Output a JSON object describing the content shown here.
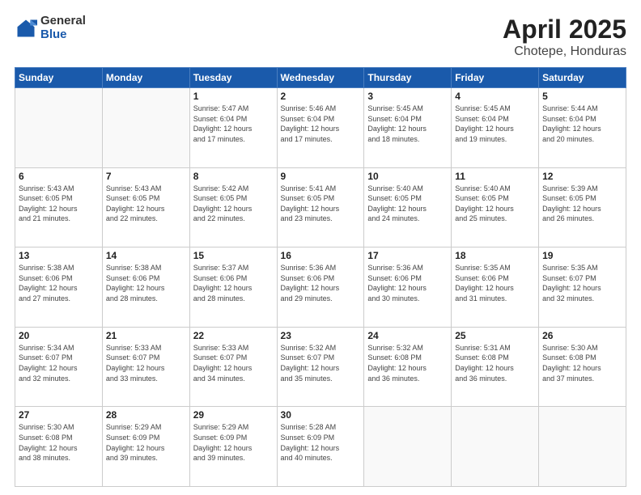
{
  "header": {
    "logo_general": "General",
    "logo_blue": "Blue",
    "title": "April 2025",
    "subtitle": "Chotepe, Honduras"
  },
  "weekdays": [
    "Sunday",
    "Monday",
    "Tuesday",
    "Wednesday",
    "Thursday",
    "Friday",
    "Saturday"
  ],
  "weeks": [
    [
      {
        "day": "",
        "info": ""
      },
      {
        "day": "",
        "info": ""
      },
      {
        "day": "1",
        "info": "Sunrise: 5:47 AM\nSunset: 6:04 PM\nDaylight: 12 hours\nand 17 minutes."
      },
      {
        "day": "2",
        "info": "Sunrise: 5:46 AM\nSunset: 6:04 PM\nDaylight: 12 hours\nand 17 minutes."
      },
      {
        "day": "3",
        "info": "Sunrise: 5:45 AM\nSunset: 6:04 PM\nDaylight: 12 hours\nand 18 minutes."
      },
      {
        "day": "4",
        "info": "Sunrise: 5:45 AM\nSunset: 6:04 PM\nDaylight: 12 hours\nand 19 minutes."
      },
      {
        "day": "5",
        "info": "Sunrise: 5:44 AM\nSunset: 6:04 PM\nDaylight: 12 hours\nand 20 minutes."
      }
    ],
    [
      {
        "day": "6",
        "info": "Sunrise: 5:43 AM\nSunset: 6:05 PM\nDaylight: 12 hours\nand 21 minutes."
      },
      {
        "day": "7",
        "info": "Sunrise: 5:43 AM\nSunset: 6:05 PM\nDaylight: 12 hours\nand 22 minutes."
      },
      {
        "day": "8",
        "info": "Sunrise: 5:42 AM\nSunset: 6:05 PM\nDaylight: 12 hours\nand 22 minutes."
      },
      {
        "day": "9",
        "info": "Sunrise: 5:41 AM\nSunset: 6:05 PM\nDaylight: 12 hours\nand 23 minutes."
      },
      {
        "day": "10",
        "info": "Sunrise: 5:40 AM\nSunset: 6:05 PM\nDaylight: 12 hours\nand 24 minutes."
      },
      {
        "day": "11",
        "info": "Sunrise: 5:40 AM\nSunset: 6:05 PM\nDaylight: 12 hours\nand 25 minutes."
      },
      {
        "day": "12",
        "info": "Sunrise: 5:39 AM\nSunset: 6:05 PM\nDaylight: 12 hours\nand 26 minutes."
      }
    ],
    [
      {
        "day": "13",
        "info": "Sunrise: 5:38 AM\nSunset: 6:06 PM\nDaylight: 12 hours\nand 27 minutes."
      },
      {
        "day": "14",
        "info": "Sunrise: 5:38 AM\nSunset: 6:06 PM\nDaylight: 12 hours\nand 28 minutes."
      },
      {
        "day": "15",
        "info": "Sunrise: 5:37 AM\nSunset: 6:06 PM\nDaylight: 12 hours\nand 28 minutes."
      },
      {
        "day": "16",
        "info": "Sunrise: 5:36 AM\nSunset: 6:06 PM\nDaylight: 12 hours\nand 29 minutes."
      },
      {
        "day": "17",
        "info": "Sunrise: 5:36 AM\nSunset: 6:06 PM\nDaylight: 12 hours\nand 30 minutes."
      },
      {
        "day": "18",
        "info": "Sunrise: 5:35 AM\nSunset: 6:06 PM\nDaylight: 12 hours\nand 31 minutes."
      },
      {
        "day": "19",
        "info": "Sunrise: 5:35 AM\nSunset: 6:07 PM\nDaylight: 12 hours\nand 32 minutes."
      }
    ],
    [
      {
        "day": "20",
        "info": "Sunrise: 5:34 AM\nSunset: 6:07 PM\nDaylight: 12 hours\nand 32 minutes."
      },
      {
        "day": "21",
        "info": "Sunrise: 5:33 AM\nSunset: 6:07 PM\nDaylight: 12 hours\nand 33 minutes."
      },
      {
        "day": "22",
        "info": "Sunrise: 5:33 AM\nSunset: 6:07 PM\nDaylight: 12 hours\nand 34 minutes."
      },
      {
        "day": "23",
        "info": "Sunrise: 5:32 AM\nSunset: 6:07 PM\nDaylight: 12 hours\nand 35 minutes."
      },
      {
        "day": "24",
        "info": "Sunrise: 5:32 AM\nSunset: 6:08 PM\nDaylight: 12 hours\nand 36 minutes."
      },
      {
        "day": "25",
        "info": "Sunrise: 5:31 AM\nSunset: 6:08 PM\nDaylight: 12 hours\nand 36 minutes."
      },
      {
        "day": "26",
        "info": "Sunrise: 5:30 AM\nSunset: 6:08 PM\nDaylight: 12 hours\nand 37 minutes."
      }
    ],
    [
      {
        "day": "27",
        "info": "Sunrise: 5:30 AM\nSunset: 6:08 PM\nDaylight: 12 hours\nand 38 minutes."
      },
      {
        "day": "28",
        "info": "Sunrise: 5:29 AM\nSunset: 6:09 PM\nDaylight: 12 hours\nand 39 minutes."
      },
      {
        "day": "29",
        "info": "Sunrise: 5:29 AM\nSunset: 6:09 PM\nDaylight: 12 hours\nand 39 minutes."
      },
      {
        "day": "30",
        "info": "Sunrise: 5:28 AM\nSunset: 6:09 PM\nDaylight: 12 hours\nand 40 minutes."
      },
      {
        "day": "",
        "info": ""
      },
      {
        "day": "",
        "info": ""
      },
      {
        "day": "",
        "info": ""
      }
    ]
  ]
}
